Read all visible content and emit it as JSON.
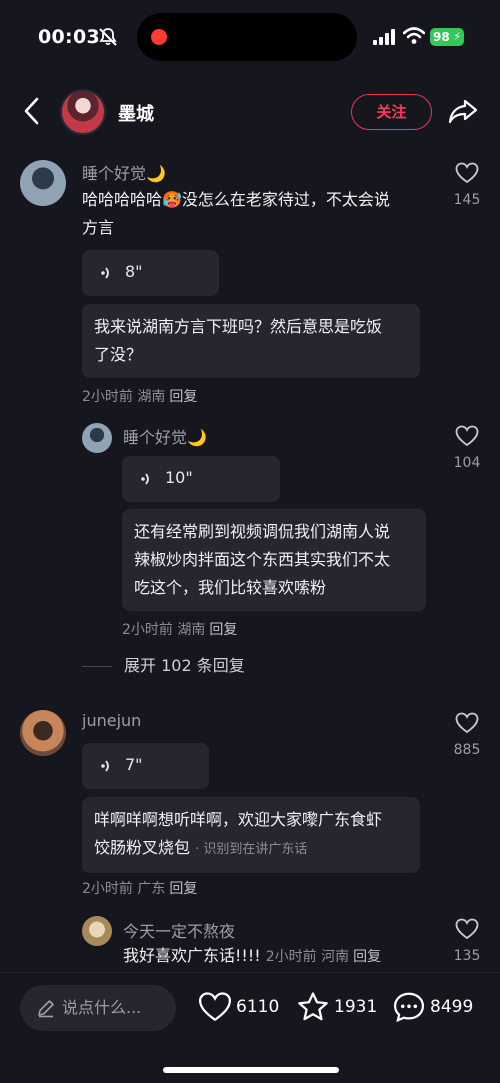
{
  "status_bar": {
    "time": "00:03",
    "battery": "98"
  },
  "header": {
    "name": "墨城",
    "follow_label": "关注"
  },
  "comments": [
    {
      "name": "睡个好觉🌙",
      "text_line1": "哈哈哈哈哈🥵没怎么在老家待过，不太会说",
      "text_line2": "方言",
      "voice_duration": "8\"",
      "transcript_line1": "我来说湖南方言下班吗？然后意思是吃饭",
      "transcript_line2": "了没？",
      "meta": "2小时前 湖南",
      "reply_label": "回复",
      "likes": "145"
    },
    {
      "name": "睡个好觉🌙",
      "voice_duration": "10\"",
      "transcript_line1": "还有经常刷到视频调侃我们湖南人说",
      "transcript_line2": "辣椒炒肉拌面这个东西其实我们不太",
      "transcript_line3": "吃这个，我们比较喜欢嗦粉",
      "meta": "2小时前 湖南",
      "reply_label": "回复",
      "likes": "104"
    },
    {
      "name": "junejun",
      "voice_duration": "7\"",
      "transcript_line1": "咩啊咩啊想听咩啊，欢迎大家嚟广东食虾",
      "transcript_line2": "饺肠粉叉烧包",
      "transcript_hint": "· 识别到在讲广东话",
      "meta": "2小时前 广东",
      "reply_label": "回复",
      "likes": "885"
    },
    {
      "name": "今天一定不熬夜",
      "text": "我好喜欢广东话!!!!",
      "meta": "2小时前 河南",
      "reply_label": "回复",
      "likes": "135"
    }
  ],
  "expand_replies": "展开 102 条回复",
  "bottom_bar": {
    "input_placeholder": "说点什么...",
    "likes": "6110",
    "favorites": "1931",
    "comments": "8499"
  },
  "colors": {
    "background": "#16161f",
    "accent": "#ff3b5c",
    "battery": "#34c759",
    "bubble": "#262631"
  },
  "icons": [
    "mute-bell-icon",
    "signal-icon",
    "wifi-icon",
    "back-arrow-icon",
    "share-icon",
    "heart-icon",
    "voice-wave-icon",
    "pen-icon",
    "star-icon",
    "comment-bubble-icon"
  ]
}
